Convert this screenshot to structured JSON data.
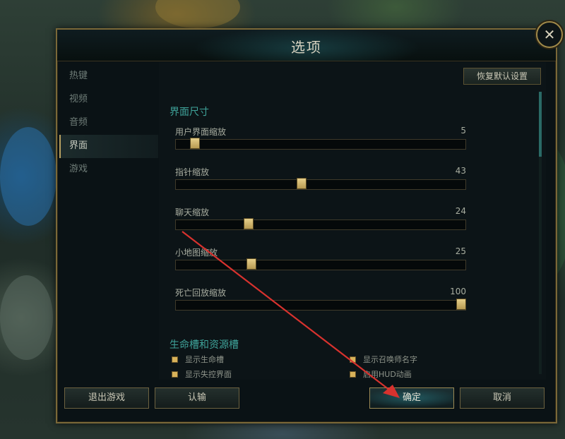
{
  "dialog": {
    "title": "选项",
    "close_glyph": "✕"
  },
  "sidebar": {
    "items": [
      {
        "label": "热键",
        "active": false
      },
      {
        "label": "视频",
        "active": false
      },
      {
        "label": "音频",
        "active": false
      },
      {
        "label": "界面",
        "active": true
      },
      {
        "label": "游戏",
        "active": false
      }
    ]
  },
  "content": {
    "reset_label": "恢复默认设置",
    "section_interface_size": "界面尺寸",
    "sliders": [
      {
        "label": "用户界面缩放",
        "value": "5"
      },
      {
        "label": "指针缩放",
        "value": "43"
      },
      {
        "label": "聊天缩放",
        "value": "24"
      },
      {
        "label": "小地图缩放",
        "value": "25"
      },
      {
        "label": "死亡回放缩放",
        "value": "100"
      }
    ],
    "section_health_bars": "生命槽和资源槽",
    "checkboxes": [
      {
        "label": "显示生命槽",
        "checked": true
      },
      {
        "label": "显示召唤师名字",
        "checked": true
      },
      {
        "label": "显示失控界面",
        "checked": true
      },
      {
        "label": "启用HUD动画",
        "checked": true
      }
    ]
  },
  "footer": {
    "exit_label": "退出游戏",
    "surrender_label": "认输",
    "ok_label": "确定",
    "cancel_label": "取消"
  },
  "colors": {
    "frame_gold": "#7a6838",
    "section_teal": "#3fa39a",
    "annotation_red": "#d8322e"
  },
  "icons": {
    "close": "close-icon",
    "arrow": "red-arrow-annotation"
  }
}
